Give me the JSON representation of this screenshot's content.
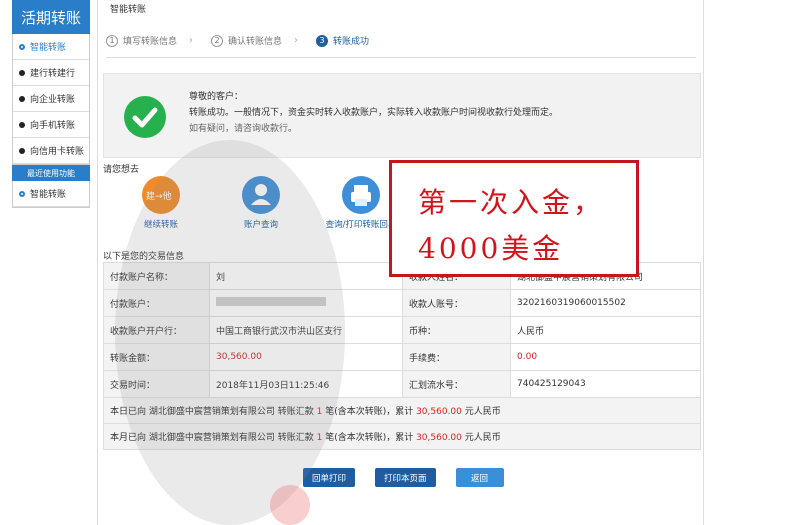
{
  "sidebar": {
    "title": "活期转账",
    "items": [
      {
        "label": "智能转账",
        "active": true
      },
      {
        "label": "建行转建行"
      },
      {
        "label": "向企业转账"
      },
      {
        "label": "向手机转账"
      },
      {
        "label": "向信用卡转账"
      }
    ],
    "section_title": "最近使用功能",
    "recent": [
      {
        "label": "智能转账"
      }
    ]
  },
  "main": {
    "title": "智能转账",
    "steps": [
      {
        "num": "1",
        "label": "填写转账信息"
      },
      {
        "num": "2",
        "label": "确认转账信息"
      },
      {
        "num": "3",
        "label": "转账成功"
      }
    ],
    "notice": {
      "greeting": "尊敬的客户：",
      "message": "转账成功。一般情况下，资金实时转入收款账户，实际转入收款账户时间视收款行处理而定。",
      "help": "如有疑问，请咨询收款行。"
    },
    "want_title": "请您想去",
    "shortcuts": [
      {
        "label": "继续转账",
        "icon_text": "建→他",
        "icon": "transfer-icon"
      },
      {
        "label": "账户查询",
        "icon": "user-icon"
      },
      {
        "label": "查询/打印转账回单",
        "icon": "printer-icon"
      }
    ],
    "info_title": "以下是您的交易信息",
    "info_rows": [
      {
        "l1": "付款账户名称：",
        "v1": "刘",
        "l2": "收款人姓名：",
        "v2": "湖北御盛中宸营销策划有限公司"
      },
      {
        "l1": "付款账户：",
        "v1": "",
        "l2": "收款人账号：",
        "v2": "3202160319060015502"
      },
      {
        "l1": "收款账户开户行：",
        "v1": "中国工商银行武汉市洪山区支行",
        "l2": "币种：",
        "v2": "人民币"
      },
      {
        "l1": "转账金额：",
        "v1": "30,560.00",
        "l2": "手续费：",
        "v2": "0.00"
      },
      {
        "l1": "交易时间：",
        "v1": "2018年11月03日11:25:46",
        "l2": "汇划流水号：",
        "v2": "740425129043"
      }
    ],
    "summary_day": {
      "prefix": "本日已向 湖北御盛中宸营销策划有限公司 转账汇款 ",
      "count": "1",
      "middle": " 笔(含本次转账)，累计 ",
      "amount": "30,560.00",
      "suffix": " 元人民币"
    },
    "summary_month": {
      "prefix": "本月已向 湖北御盛中宸营销策划有限公司 转账汇款 ",
      "count": "1",
      "middle": " 笔(含本次转账)，累计 ",
      "amount": "30,560.00",
      "suffix": " 元人民币"
    },
    "buttons": {
      "print_receipt": "回单打印",
      "print_page": "打印本页面",
      "back": "返回"
    }
  },
  "annotation": {
    "line1": "第一次入金，",
    "line2": "4000美金"
  },
  "colors": {
    "brand_blue": "#2a7dc8",
    "dark_blue": "#1f5da0",
    "success_green": "#27b04e",
    "alert_red": "#e02020",
    "annotation_red": "#c4161c"
  }
}
